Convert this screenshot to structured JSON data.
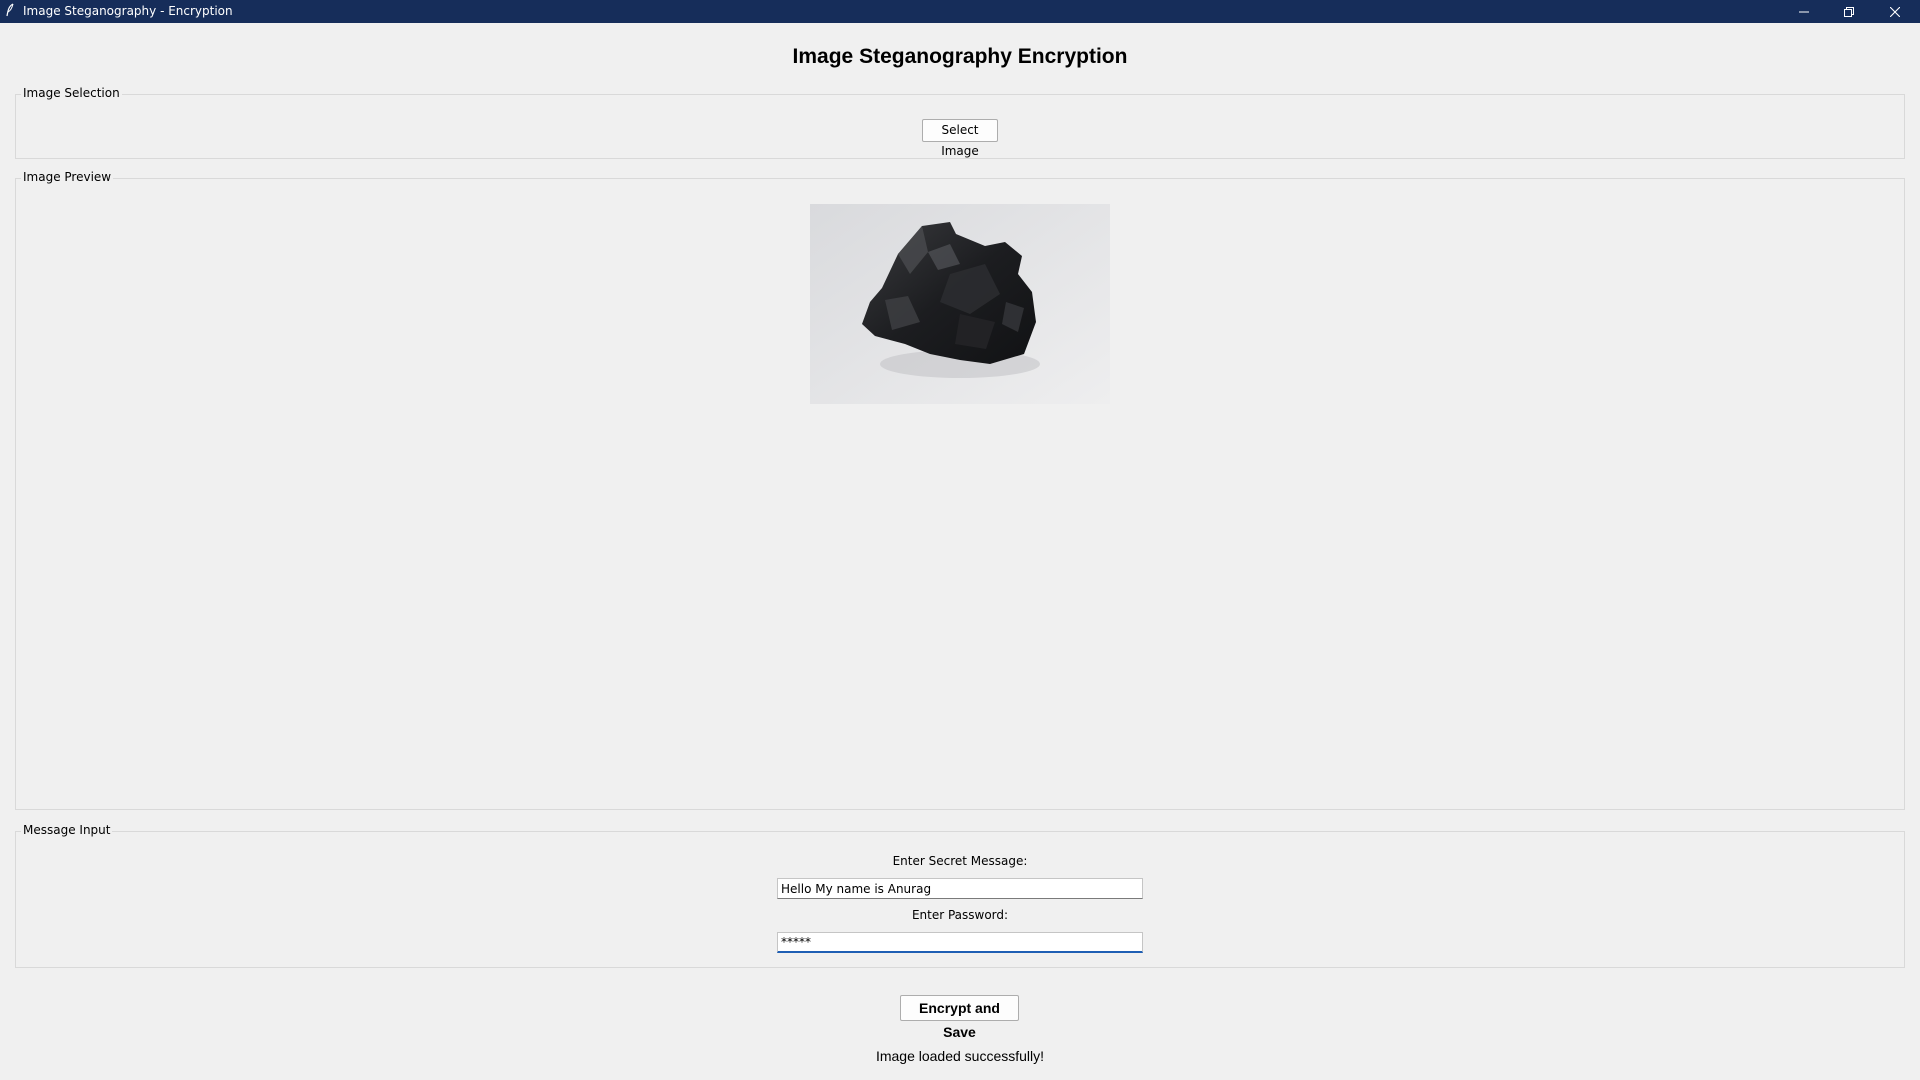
{
  "window": {
    "title": "Image Steganography - Encryption",
    "app_icon": "feather-icon",
    "controls": [
      "minimize-icon",
      "restore-icon",
      "close-icon"
    ]
  },
  "heading": "Image Steganography Encryption",
  "image_selection": {
    "legend": "Image Selection",
    "select_button": "Select Image"
  },
  "image_preview": {
    "legend": "Image Preview",
    "image_subject": "lump of coal on white background"
  },
  "message_input": {
    "legend": "Message Input",
    "secret_label": "Enter Secret Message:",
    "secret_value": "Hello My name is Anurag",
    "password_label": "Enter Password:",
    "password_value": "*****"
  },
  "encrypt_button": "Encrypt and Save",
  "status": "Image loaded successfully!",
  "colors": {
    "titlebar": "#162d5a",
    "background": "#f0f0f0",
    "focus_underline": "#1f5fb4"
  }
}
